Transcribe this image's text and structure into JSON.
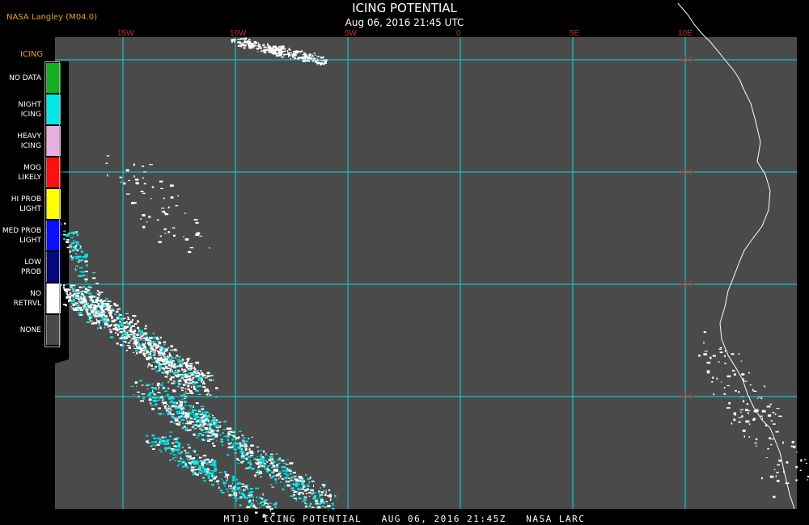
{
  "header": {
    "title": "ICING POTENTIAL",
    "subtitle": "Aug 06, 2016 21:45 UTC",
    "agency": "NASA Langley (M04.0)"
  },
  "footer": {
    "text": "MT10  ICING POTENTIAL   AUG 06, 2016 21:45Z   NASA LARC"
  },
  "legend": {
    "title": "ICING",
    "items": [
      {
        "label": "NO DATA",
        "color": "#10b020"
      },
      {
        "label": "NIGHT\nICING",
        "color": "#00e8e8"
      },
      {
        "label": "HEAVY\nICING",
        "color": "#e8b0e0"
      },
      {
        "label": "MOG\nLIKELY",
        "color": "#ff1010"
      },
      {
        "label": "HI PROB\nLIGHT",
        "color": "#ffff00"
      },
      {
        "label": "MED PROB\nLIGHT",
        "color": "#0a10ff"
      },
      {
        "label": "LOW\nPROB",
        "color": "#05087a"
      },
      {
        "label": "NO\nRETRVL",
        "color": "#ffffff"
      },
      {
        "label": "NONE",
        "color": "#4a4a4a"
      }
    ]
  },
  "map": {
    "background_color": "#4a4a4a",
    "grid_color": "#00e0e0",
    "coast_color": "#ffffff",
    "lon_labels": [
      "15W",
      "10W",
      "5W",
      "0",
      "5E",
      "10E"
    ],
    "lat_labels": [
      "15S",
      "20S",
      "25S",
      "30S"
    ],
    "label_color": "#c03030"
  }
}
